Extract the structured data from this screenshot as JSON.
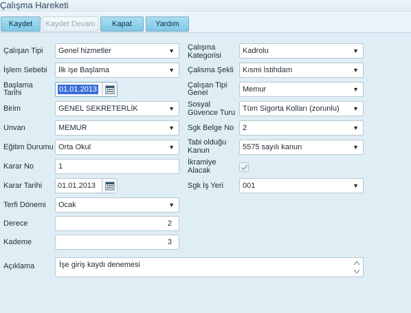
{
  "window": {
    "title": "Çalışma Hareketi"
  },
  "toolbar": {
    "save": "Kaydet",
    "save_continue": "Kaydet Devam",
    "close": "Kapat",
    "help": "Yardım"
  },
  "form": {
    "calisan_tipi": {
      "label": "Çalışan Tipi",
      "value": "Genel hizmetler"
    },
    "islem_sebebi": {
      "label": "İşlem Sebebi",
      "value": "İlk işe Başlama"
    },
    "baslama_tarihi": {
      "label_line1": "Başlama",
      "label_line2": "Tarihi",
      "value": "01.01.2013"
    },
    "birim": {
      "label": "Birim",
      "value": "GENEL SEKRETERLİK"
    },
    "unvan": {
      "label": "Unvan",
      "value": "MEMUR"
    },
    "egitim_durumu": {
      "label": "Eğitim Durumu",
      "value": "Orta Okul"
    },
    "karar_no": {
      "label": "Karar No",
      "value": "1"
    },
    "karar_tarihi": {
      "label": "Karar Tarihi",
      "value": "01.01.2013"
    },
    "terfi_donemi": {
      "label": "Terfi Dönemi",
      "value": "Ocak"
    },
    "derece": {
      "label": "Derece",
      "value": "2"
    },
    "kademe": {
      "label": "Kademe",
      "value": "3"
    },
    "calisma_kategorisi": {
      "label_line1": "Çalışma",
      "label_line2": "Kategorisi",
      "value": "Kadrolu"
    },
    "calisma_sekli": {
      "label": "Çalisma Şekli",
      "value": "Kısmi İstihdam"
    },
    "calisan_tipi_genel": {
      "label_line1": "Çalışan Tipi",
      "label_line2": "Genel",
      "value": "Memur"
    },
    "sosyal_guvence": {
      "label_line1": "Sosyal",
      "label_line2": "Güvence Turu",
      "value": "Tüm Sigorta Kolları (zorunlu)"
    },
    "sgk_belge_no": {
      "label": "Sgk Belge No",
      "value": "2"
    },
    "tabi_oldugu_kanun": {
      "label_line1": "Tabi olduğu",
      "label_line2": "Kanun",
      "value": "5575 sayılı kanun"
    },
    "ikramiye_alacak": {
      "label_line1": "İkramiye",
      "label_line2": "Alacak",
      "checked": true
    },
    "sgk_is_yeri": {
      "label": "Sgk İş Yeri",
      "value": "001"
    },
    "aciklama": {
      "label": "Açıklama",
      "value": "İşe giriş kaydı denemesi"
    }
  },
  "icons": {
    "dropdown": "chevron-down-icon",
    "calendar": "calendar-icon",
    "check": "check-icon"
  }
}
